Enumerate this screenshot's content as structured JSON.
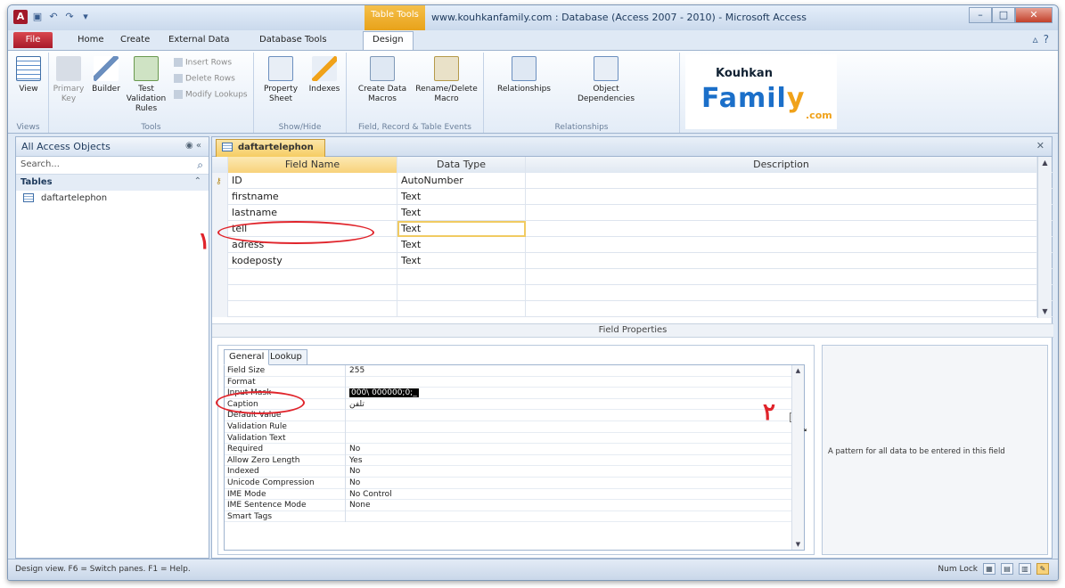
{
  "window": {
    "title": "www.kouhkanfamily.com : Database (Access 2007 - 2010) - Microsoft Access",
    "tool_tab": "Table Tools",
    "controls": [
      "–",
      "□",
      "✕"
    ]
  },
  "ribbon_tabs": {
    "file": "File",
    "tabs": [
      "Home",
      "Create",
      "External Data",
      "Database Tools",
      "Design"
    ]
  },
  "ribbon": {
    "views": {
      "view_label": "View",
      "group": "Views"
    },
    "tools": {
      "primary_key": "Primary Key",
      "builder": "Builder",
      "test_validation": "Test Validation Rules",
      "insert_rows": "Insert Rows",
      "delete_rows": "Delete Rows",
      "modify_lookups": "Modify Lookups",
      "group": "Tools"
    },
    "showhide": {
      "property_sheet": "Property Sheet",
      "indexes": "Indexes",
      "group": "Show/Hide"
    },
    "events": {
      "create_macros": "Create Data Macros",
      "rename_macro": "Rename/Delete Macro",
      "group": "Field, Record & Table Events"
    },
    "relationships": {
      "relationships": "Relationships",
      "object_dependencies": "Object Dependencies",
      "group": "Relationships"
    },
    "logo": {
      "top": "Kouhkan",
      "main_a": "Famil",
      "main_b": "y",
      "domain": ".com"
    }
  },
  "nav": {
    "header": "All Access Objects",
    "search_placeholder": "Search...",
    "group": "Tables",
    "items": [
      "daftartelephon"
    ]
  },
  "document": {
    "tab": "daftartelephon",
    "columns": [
      "Field Name",
      "Data Type",
      "Description"
    ],
    "rows": [
      {
        "name": "ID",
        "type": "AutoNumber",
        "key": true
      },
      {
        "name": "firstname",
        "type": "Text"
      },
      {
        "name": "lastname",
        "type": "Text"
      },
      {
        "name": "tell",
        "type": "Text"
      },
      {
        "name": "adress",
        "type": "Text"
      },
      {
        "name": "kodeposty",
        "type": "Text"
      }
    ],
    "field_properties_label": "Field Properties"
  },
  "properties": {
    "tabs": [
      "General",
      "Lookup"
    ],
    "rows": [
      {
        "label": "Field Size",
        "value": "255"
      },
      {
        "label": "Format",
        "value": ""
      },
      {
        "label": "Input Mask",
        "value": "000\\ 000000;0;_"
      },
      {
        "label": "Caption",
        "value": "تلفن"
      },
      {
        "label": "Default Value",
        "value": ""
      },
      {
        "label": "Validation Rule",
        "value": ""
      },
      {
        "label": "Validation Text",
        "value": ""
      },
      {
        "label": "Required",
        "value": "No"
      },
      {
        "label": "Allow Zero Length",
        "value": "Yes"
      },
      {
        "label": "Indexed",
        "value": "No"
      },
      {
        "label": "Unicode Compression",
        "value": "No"
      },
      {
        "label": "IME Mode",
        "value": "No Control"
      },
      {
        "label": "IME Sentence Mode",
        "value": "None"
      },
      {
        "label": "Smart Tags",
        "value": ""
      }
    ],
    "help_text": "A pattern for all data to be entered in this field"
  },
  "annotations": {
    "one": "١",
    "two": "٢",
    "color": "#e0242b"
  },
  "status": {
    "text": "Design view.  F6 = Switch panes.  F1 = Help.",
    "numlock": "Num Lock"
  }
}
